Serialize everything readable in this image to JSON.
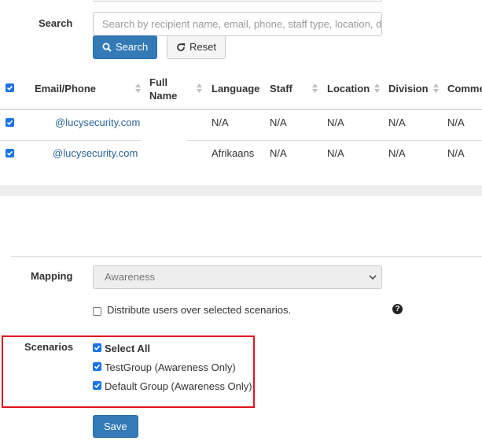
{
  "search": {
    "label": "Search",
    "placeholder": "Search by recipient name, email, phone, staff type, location, d",
    "search_button": "Search",
    "reset_button": "Reset"
  },
  "table": {
    "headers": {
      "email_phone": "Email/Phone",
      "full_name_1": "Full",
      "full_name_2": "Name",
      "language": "Language",
      "staff": "Staff",
      "location": "Location",
      "division": "Division",
      "comments": "Comme"
    },
    "rows": [
      {
        "email": "@lucysecurity.com",
        "full_name": "",
        "language": "N/A",
        "staff": "N/A",
        "location": "N/A",
        "division": "N/A",
        "comments": "N/A"
      },
      {
        "email": "@lucysecurity.com",
        "full_name": "",
        "language": "Afrikaans",
        "staff": "N/A",
        "location": "N/A",
        "division": "N/A",
        "comments": "N/A"
      }
    ]
  },
  "mapping": {
    "label": "Mapping",
    "selected": "Awareness",
    "distribute_label": "Distribute users over selected scenarios.",
    "distribute_checked": false
  },
  "scenarios": {
    "label": "Scenarios",
    "select_all": "Select All",
    "items": [
      {
        "label": "TestGroup (Awareness Only)",
        "checked": true
      },
      {
        "label": "Default Group (Awareness Only)",
        "checked": true
      }
    ]
  },
  "save_button": "Save",
  "colors": {
    "primary": "#337ab7",
    "link": "#2a6496",
    "checkbox": "#1a73e8",
    "highlight_border": "#e0141e"
  }
}
